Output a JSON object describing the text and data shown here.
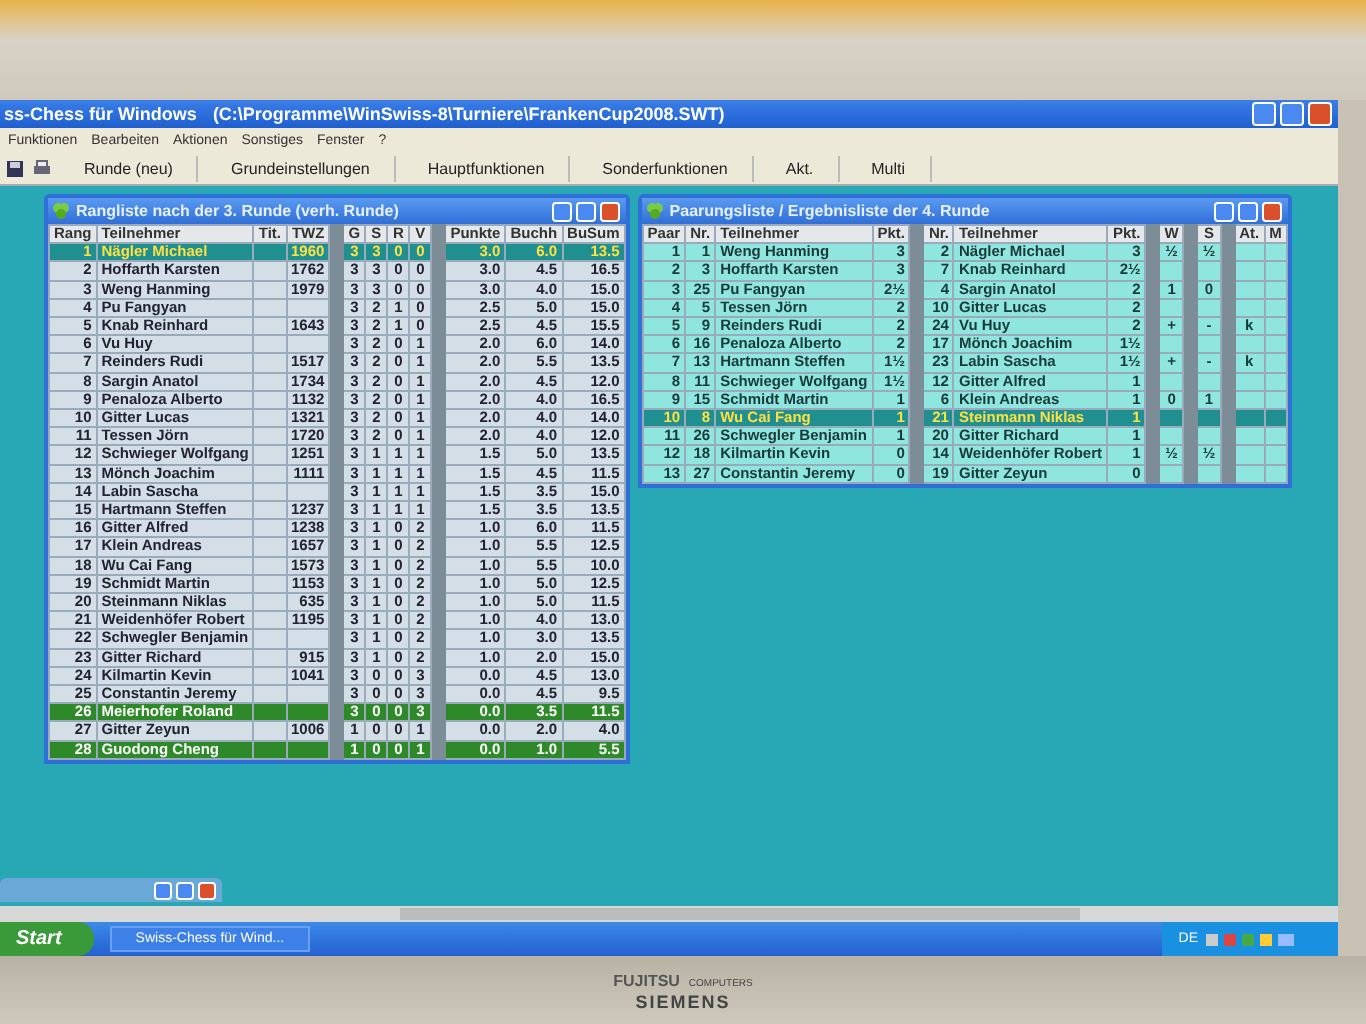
{
  "app": {
    "title": "ss-Chess für Windows",
    "path": "(C:\\Programme\\WinSwiss-8\\Turniere\\FrankenCup2008.SWT)"
  },
  "menu": [
    "Funktionen",
    "Bearbeiten",
    "Aktionen",
    "Sonstiges",
    "Fenster",
    "?"
  ],
  "toolbar": [
    "Runde (neu)",
    "Grundeinstellungen",
    "Hauptfunktionen",
    "Sonderfunktionen",
    "Akt.",
    "Multi"
  ],
  "ranking": {
    "title": "Rangliste nach der 3. Runde (verh. Runde)",
    "columns": [
      {
        "label": "Rang",
        "kind": "num"
      },
      {
        "label": "Teilnehmer",
        "kind": "name"
      },
      {
        "label": "Tit.",
        "kind": "num"
      },
      {
        "label": "TWZ",
        "kind": "num"
      },
      {
        "label": "G",
        "kind": "mid"
      },
      {
        "label": "S",
        "kind": "mid"
      },
      {
        "label": "R",
        "kind": "mid"
      },
      {
        "label": "V",
        "kind": "mid"
      },
      {
        "label": "Punkte",
        "kind": "num"
      },
      {
        "label": "Buchh",
        "kind": "num"
      },
      {
        "label": "BuSum",
        "kind": "num"
      }
    ],
    "rows": [
      {
        "cells": [
          "1",
          "Nägler Michael",
          "",
          "1960",
          "3",
          "3",
          "0",
          "0",
          "3.0",
          "6.0",
          "13.5"
        ],
        "selected": true,
        "marked": false
      },
      {
        "cells": [
          "2",
          "Hoffarth Karsten",
          "",
          "1762",
          "3",
          "3",
          "0",
          "0",
          "3.0",
          "4.5",
          "16.5"
        ],
        "selected": false,
        "marked": false
      },
      {
        "cells": [
          "3",
          "Weng Hanming",
          "",
          "1979",
          "3",
          "3",
          "0",
          "0",
          "3.0",
          "4.0",
          "15.0"
        ],
        "selected": false,
        "marked": false
      },
      {
        "cells": [
          "4",
          "Pu Fangyan",
          "",
          "",
          "3",
          "2",
          "1",
          "0",
          "2.5",
          "5.0",
          "15.0"
        ],
        "selected": false,
        "marked": false
      },
      {
        "cells": [
          "5",
          "Knab Reinhard",
          "",
          "1643",
          "3",
          "2",
          "1",
          "0",
          "2.5",
          "4.5",
          "15.5"
        ],
        "selected": false,
        "marked": false
      },
      {
        "cells": [
          "6",
          "Vu Huy",
          "",
          "",
          "3",
          "2",
          "0",
          "1",
          "2.0",
          "6.0",
          "14.0"
        ],
        "selected": false,
        "marked": false
      },
      {
        "cells": [
          "7",
          "Reinders Rudi",
          "",
          "1517",
          "3",
          "2",
          "0",
          "1",
          "2.0",
          "5.5",
          "13.5"
        ],
        "selected": false,
        "marked": false
      },
      {
        "cells": [
          "8",
          "Sargin Anatol",
          "",
          "1734",
          "3",
          "2",
          "0",
          "1",
          "2.0",
          "4.5",
          "12.0"
        ],
        "selected": false,
        "marked": false
      },
      {
        "cells": [
          "9",
          "Penaloza Alberto",
          "",
          "1132",
          "3",
          "2",
          "0",
          "1",
          "2.0",
          "4.0",
          "16.5"
        ],
        "selected": false,
        "marked": false
      },
      {
        "cells": [
          "10",
          "Gitter Lucas",
          "",
          "1321",
          "3",
          "2",
          "0",
          "1",
          "2.0",
          "4.0",
          "14.0"
        ],
        "selected": false,
        "marked": false
      },
      {
        "cells": [
          "11",
          "Tessen Jörn",
          "",
          "1720",
          "3",
          "2",
          "0",
          "1",
          "2.0",
          "4.0",
          "12.0"
        ],
        "selected": false,
        "marked": false
      },
      {
        "cells": [
          "12",
          "Schwieger Wolfgang",
          "",
          "1251",
          "3",
          "1",
          "1",
          "1",
          "1.5",
          "5.0",
          "13.5"
        ],
        "selected": false,
        "marked": false
      },
      {
        "cells": [
          "13",
          "Mönch Joachim",
          "",
          "1111",
          "3",
          "1",
          "1",
          "1",
          "1.5",
          "4.5",
          "11.5"
        ],
        "selected": false,
        "marked": false
      },
      {
        "cells": [
          "14",
          "Labin Sascha",
          "",
          "",
          "3",
          "1",
          "1",
          "1",
          "1.5",
          "3.5",
          "15.0"
        ],
        "selected": false,
        "marked": false
      },
      {
        "cells": [
          "15",
          "Hartmann Steffen",
          "",
          "1237",
          "3",
          "1",
          "1",
          "1",
          "1.5",
          "3.5",
          "13.5"
        ],
        "selected": false,
        "marked": false
      },
      {
        "cells": [
          "16",
          "Gitter Alfred",
          "",
          "1238",
          "3",
          "1",
          "0",
          "2",
          "1.0",
          "6.0",
          "11.5"
        ],
        "selected": false,
        "marked": false
      },
      {
        "cells": [
          "17",
          "Klein Andreas",
          "",
          "1657",
          "3",
          "1",
          "0",
          "2",
          "1.0",
          "5.5",
          "12.5"
        ],
        "selected": false,
        "marked": false
      },
      {
        "cells": [
          "18",
          "Wu Cai Fang",
          "",
          "1573",
          "3",
          "1",
          "0",
          "2",
          "1.0",
          "5.5",
          "10.0"
        ],
        "selected": false,
        "marked": false
      },
      {
        "cells": [
          "19",
          "Schmidt Martin",
          "",
          "1153",
          "3",
          "1",
          "0",
          "2",
          "1.0",
          "5.0",
          "12.5"
        ],
        "selected": false,
        "marked": false
      },
      {
        "cells": [
          "20",
          "Steinmann Niklas",
          "",
          "635",
          "3",
          "1",
          "0",
          "2",
          "1.0",
          "5.0",
          "11.5"
        ],
        "selected": false,
        "marked": false
      },
      {
        "cells": [
          "21",
          "Weidenhöfer Robert",
          "",
          "1195",
          "3",
          "1",
          "0",
          "2",
          "1.0",
          "4.0",
          "13.0"
        ],
        "selected": false,
        "marked": false
      },
      {
        "cells": [
          "22",
          "Schwegler Benjamin",
          "",
          "",
          "3",
          "1",
          "0",
          "2",
          "1.0",
          "3.0",
          "13.5"
        ],
        "selected": false,
        "marked": false
      },
      {
        "cells": [
          "23",
          "Gitter Richard",
          "",
          "915",
          "3",
          "1",
          "0",
          "2",
          "1.0",
          "2.0",
          "15.0"
        ],
        "selected": false,
        "marked": false
      },
      {
        "cells": [
          "24",
          "Kilmartin Kevin",
          "",
          "1041",
          "3",
          "0",
          "0",
          "3",
          "0.0",
          "4.5",
          "13.0"
        ],
        "selected": false,
        "marked": false
      },
      {
        "cells": [
          "25",
          "Constantin Jeremy",
          "",
          "",
          "3",
          "0",
          "0",
          "3",
          "0.0",
          "4.5",
          "9.5"
        ],
        "selected": false,
        "marked": false
      },
      {
        "cells": [
          "26",
          "Meierhofer Roland",
          "",
          "",
          "3",
          "0",
          "0",
          "3",
          "0.0",
          "3.5",
          "11.5"
        ],
        "selected": false,
        "marked": true
      },
      {
        "cells": [
          "27",
          "Gitter Zeyun",
          "",
          "1006",
          "1",
          "0",
          "0",
          "1",
          "0.0",
          "2.0",
          "4.0"
        ],
        "selected": false,
        "marked": false
      },
      {
        "cells": [
          "28",
          "Guodong Cheng",
          "",
          "",
          "1",
          "0",
          "0",
          "1",
          "0.0",
          "1.0",
          "5.5"
        ],
        "selected": false,
        "marked": true
      }
    ]
  },
  "pairings": {
    "title": "Paarungsliste / Ergebnisliste der 4. Runde",
    "columns": [
      {
        "label": "Paar",
        "kind": "num"
      },
      {
        "label": "Nr.",
        "kind": "num"
      },
      {
        "label": "Teilnehmer",
        "kind": "name"
      },
      {
        "label": "Pkt.",
        "kind": "num"
      },
      {
        "label": "Nr.",
        "kind": "num"
      },
      {
        "label": "Teilnehmer",
        "kind": "name"
      },
      {
        "label": "Pkt.",
        "kind": "num"
      },
      {
        "label": "W",
        "kind": "mid"
      },
      {
        "label": "S",
        "kind": "mid"
      },
      {
        "label": "At.",
        "kind": "mid"
      },
      {
        "label": "M",
        "kind": "mid"
      }
    ],
    "rows": [
      {
        "cells": [
          "1",
          "1",
          "Weng Hanming",
          "3",
          "2",
          "Nägler Michael",
          "3",
          "½",
          "½",
          "",
          ""
        ],
        "selected": false
      },
      {
        "cells": [
          "2",
          "3",
          "Hoffarth Karsten",
          "3",
          "7",
          "Knab Reinhard",
          "2½",
          "",
          "",
          "",
          ""
        ],
        "selected": false
      },
      {
        "cells": [
          "3",
          "25",
          "Pu Fangyan",
          "2½",
          "4",
          "Sargin Anatol",
          "2",
          "1",
          "0",
          "",
          ""
        ],
        "selected": false
      },
      {
        "cells": [
          "4",
          "5",
          "Tessen Jörn",
          "2",
          "10",
          "Gitter Lucas",
          "2",
          "",
          "",
          "",
          ""
        ],
        "selected": false
      },
      {
        "cells": [
          "5",
          "9",
          "Reinders Rudi",
          "2",
          "24",
          "Vu Huy",
          "2",
          "+",
          "-",
          "k",
          ""
        ],
        "selected": false
      },
      {
        "cells": [
          "6",
          "16",
          "Penaloza Alberto",
          "2",
          "17",
          "Mönch Joachim",
          "1½",
          "",
          "",
          "",
          ""
        ],
        "selected": false
      },
      {
        "cells": [
          "7",
          "13",
          "Hartmann Steffen",
          "1½",
          "23",
          "Labin Sascha",
          "1½",
          "+",
          "-",
          "k",
          ""
        ],
        "selected": false
      },
      {
        "cells": [
          "8",
          "11",
          "Schwieger Wolfgang",
          "1½",
          "12",
          "Gitter Alfred",
          "1",
          "",
          "",
          "",
          ""
        ],
        "selected": false
      },
      {
        "cells": [
          "9",
          "15",
          "Schmidt Martin",
          "1",
          "6",
          "Klein Andreas",
          "1",
          "0",
          "1",
          "",
          ""
        ],
        "selected": false
      },
      {
        "cells": [
          "10",
          "8",
          "Wu Cai Fang",
          "1",
          "21",
          "Steinmann Niklas",
          "1",
          "",
          "",
          "",
          ""
        ],
        "selected": true
      },
      {
        "cells": [
          "11",
          "26",
          "Schwegler Benjamin",
          "1",
          "20",
          "Gitter Richard",
          "1",
          "",
          "",
          "",
          ""
        ],
        "selected": false
      },
      {
        "cells": [
          "12",
          "18",
          "Kilmartin Kevin",
          "0",
          "14",
          "Weidenhöfer Robert",
          "1",
          "½",
          "½",
          "",
          ""
        ],
        "selected": false
      },
      {
        "cells": [
          "13",
          "27",
          "Constantin Jeremy",
          "0",
          "19",
          "Gitter Zeyun",
          "0",
          "",
          "",
          "",
          ""
        ],
        "selected": false
      }
    ]
  },
  "taskbar": {
    "start": "Start",
    "task": "Swiss-Chess für Wind...",
    "language": "DE"
  },
  "brand": {
    "name": "FUJITSU",
    "sub": "COMPUTERS",
    "second": "SIEMENS"
  }
}
